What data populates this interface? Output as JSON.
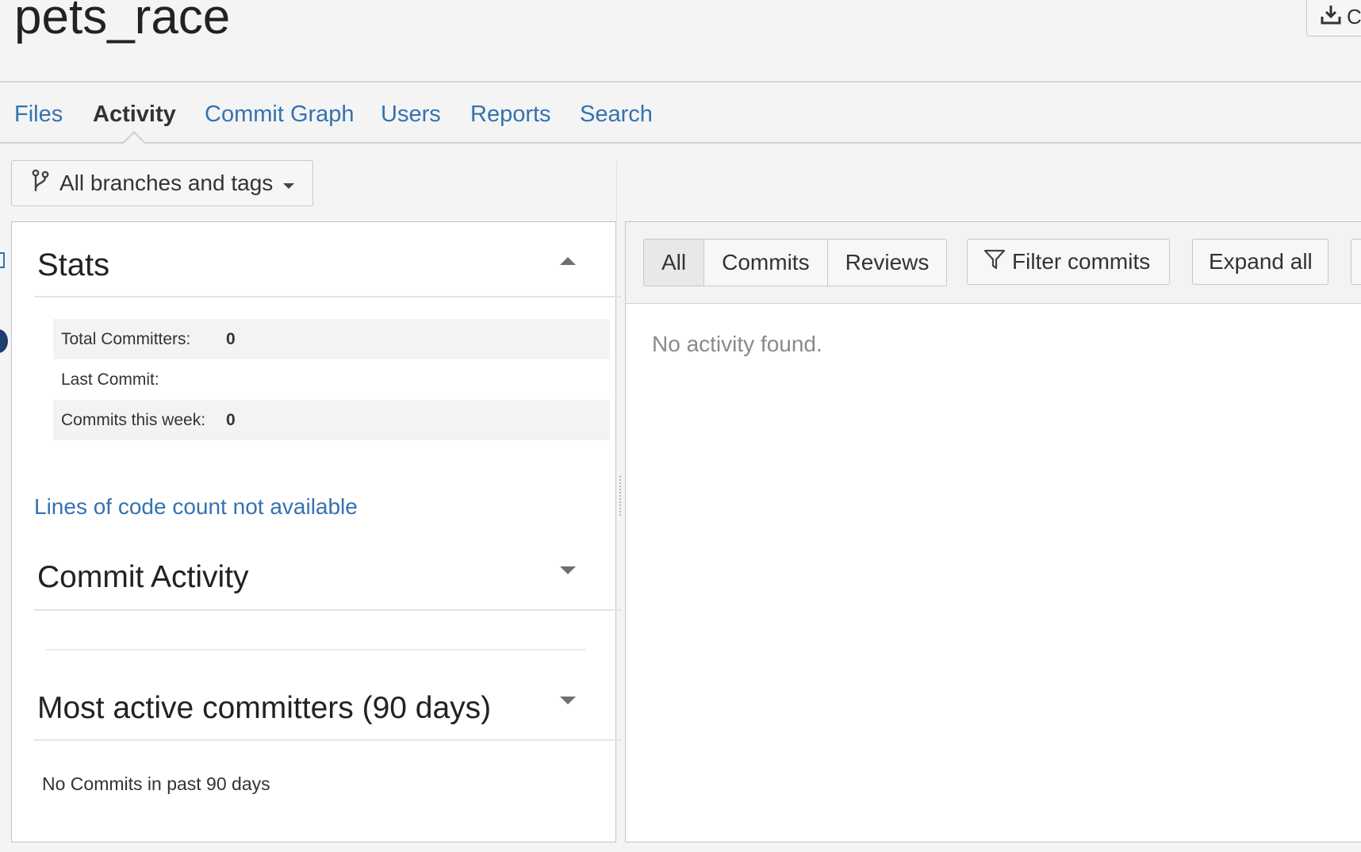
{
  "repo": {
    "title": "pets_race"
  },
  "header": {
    "download_label": "C",
    "download_icon": "download-icon"
  },
  "nav": {
    "tabs": [
      {
        "label": "Files",
        "active": false
      },
      {
        "label": "Activity",
        "active": true
      },
      {
        "label": "Commit Graph",
        "active": false
      },
      {
        "label": "Users",
        "active": false
      },
      {
        "label": "Reports",
        "active": false
      },
      {
        "label": "Search",
        "active": false
      }
    ]
  },
  "branch_selector": {
    "label": "All branches and tags",
    "icon": "branch-icon"
  },
  "stats": {
    "heading": "Stats",
    "rows": [
      {
        "label": "Total Committers:",
        "value": "0"
      },
      {
        "label": "Last Commit:",
        "value": ""
      },
      {
        "label": "Commits this week:",
        "value": "0"
      }
    ],
    "loc_link": "Lines of code count not available"
  },
  "commit_activity": {
    "heading": "Commit Activity"
  },
  "most_active": {
    "heading": "Most active committers (90 days)",
    "empty_text": "No Commits in past 90 days"
  },
  "activity": {
    "filters": [
      "All",
      "Commits",
      "Reviews"
    ],
    "selected_filter": "All",
    "filter_commits_label": "Filter commits",
    "expand_all_label": "Expand all",
    "empty_text": "No activity found."
  },
  "colors": {
    "link": "#3572b0",
    "text": "#333333",
    "background": "#f4f4f4"
  }
}
